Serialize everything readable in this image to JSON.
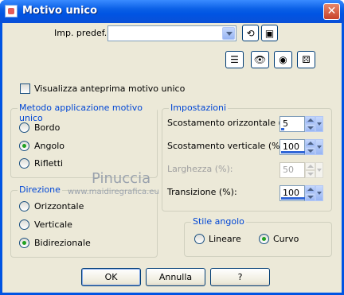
{
  "window": {
    "title": "Motivo unico"
  },
  "preset": {
    "label": "Imp. predef.:",
    "value": ""
  },
  "preview_check": {
    "label": "Visualizza anteprima motivo unico",
    "checked": false
  },
  "method_group": {
    "title": "Metodo applicazione motivo unico",
    "options": [
      {
        "label": "Bordo",
        "selected": false
      },
      {
        "label": "Angolo",
        "selected": true
      },
      {
        "label": "Rifletti",
        "selected": false
      }
    ]
  },
  "direction_group": {
    "title": "Direzione",
    "options": [
      {
        "label": "Orizzontale",
        "selected": false
      },
      {
        "label": "Verticale",
        "selected": false
      },
      {
        "label": "Bidirezionale",
        "selected": true
      }
    ]
  },
  "settings_group": {
    "title": "Impostazioni",
    "fields": [
      {
        "label": "Scostamento orizzontale (%):",
        "value": "5",
        "enabled": true
      },
      {
        "label": "Scostamento verticale (%):",
        "value": "100",
        "enabled": true
      },
      {
        "label": "Larghezza (%):",
        "value": "50",
        "enabled": false
      },
      {
        "label": "Transizione (%):",
        "value": "100",
        "enabled": true
      }
    ]
  },
  "corner_group": {
    "title": "Stile angolo",
    "options": [
      {
        "label": "Lineare",
        "selected": false
      },
      {
        "label": "Curvo",
        "selected": true
      }
    ]
  },
  "buttons": {
    "ok": "OK",
    "cancel": "Annulla",
    "help": "?"
  },
  "watermark": {
    "name": "Pinuccia",
    "site": "www.maidiregrafica.eu"
  },
  "colors": {
    "titlebar": "#0054e3",
    "group_title": "#0046d5",
    "dialog_bg": "#ece9d8"
  }
}
